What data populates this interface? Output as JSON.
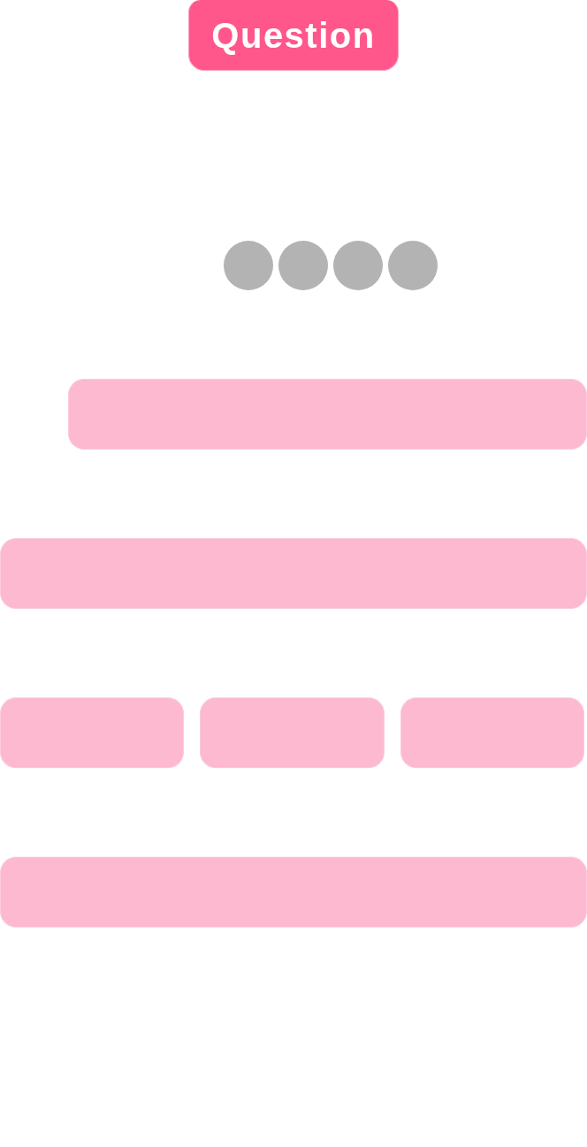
{
  "title_tag": {
    "label": "Question"
  },
  "progress_dots": [
    {
      "kind": "dot"
    },
    {
      "kind": "dot"
    },
    {
      "kind": "dot"
    },
    {
      "kind": "dot"
    }
  ],
  "answer_rows": [
    {
      "kind": "indented",
      "blanks": [
        {
          "kind": "blank"
        }
      ]
    },
    {
      "kind": "full",
      "blanks": [
        {
          "kind": "blank"
        }
      ]
    },
    {
      "kind": "split",
      "blanks": [
        {
          "kind": "blank"
        },
        {
          "kind": "blank"
        },
        {
          "kind": "blank"
        }
      ]
    },
    {
      "kind": "full",
      "blanks": [
        {
          "kind": "blank"
        }
      ]
    }
  ]
}
